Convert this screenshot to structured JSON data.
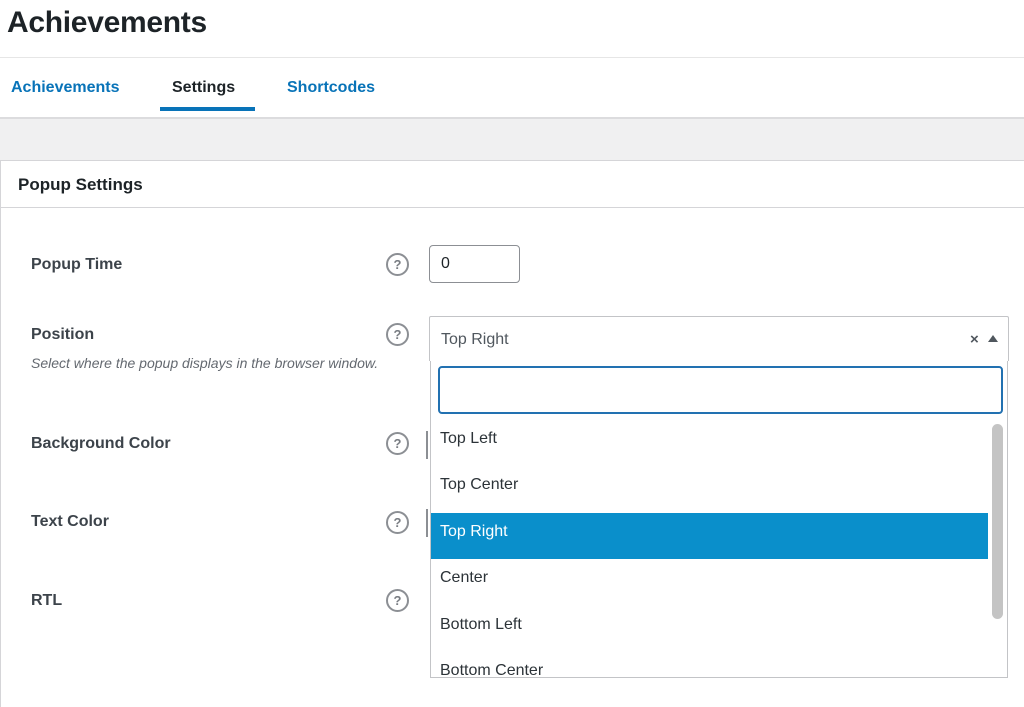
{
  "page": {
    "title": "Achievements"
  },
  "tabs": [
    {
      "label": "Achievements",
      "active": false
    },
    {
      "label": "Settings",
      "active": true
    },
    {
      "label": "Shortcodes",
      "active": false
    }
  ],
  "card": {
    "title": "Popup Settings",
    "rows": {
      "popup_time": {
        "label": "Popup Time",
        "value": "0"
      },
      "position": {
        "label": "Position",
        "description": "Select where the popup displays in the browser window.",
        "selected": "Top Right",
        "search_value": "",
        "options": [
          "Top Left",
          "Top Center",
          "Top Right",
          "Center",
          "Bottom Left",
          "Bottom Center"
        ],
        "selected_index": 2
      },
      "background_color": {
        "label": "Background Color"
      },
      "text_color": {
        "label": "Text Color"
      },
      "rtl": {
        "label": "RTL"
      }
    }
  },
  "icons": {
    "help": "?",
    "clear": "×"
  },
  "colors": {
    "accent": "#0873b8",
    "selected_option": "#0a8fcb",
    "focus_border": "#2271b1"
  }
}
